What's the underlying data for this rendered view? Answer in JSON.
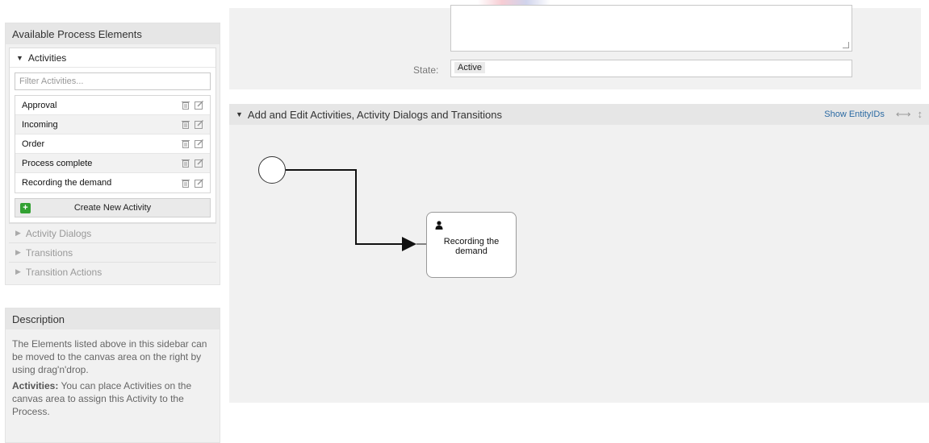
{
  "sidebar": {
    "available_title": "Available Process Elements",
    "activities": {
      "label": "Activities",
      "filter_placeholder": "Filter Activities...",
      "items": [
        {
          "label": "Approval"
        },
        {
          "label": "Incoming"
        },
        {
          "label": "Order"
        },
        {
          "label": "Process complete"
        },
        {
          "label": "Recording the demand"
        }
      ],
      "create_label": "Create New Activity"
    },
    "collapsed_sections": [
      {
        "label": "Activity Dialogs"
      },
      {
        "label": "Transitions"
      },
      {
        "label": "Transition Actions"
      }
    ],
    "description": {
      "title": "Description",
      "text1": "The Elements listed above in this sidebar can be moved to the canvas area on the right by using drag'n'drop.",
      "text2_bold": "Activities:",
      "text2": " You can place Activities on the canvas area to assign this Activity to the Process."
    }
  },
  "main": {
    "state_label": "State:",
    "state_value": "Active",
    "canvas_title": "Add and Edit Activities, Activity Dialogs and Transitions",
    "show_entity_ids": "Show EntityIDs",
    "activity_box_label": "Recording the demand"
  },
  "icons": {
    "delete": "trash-icon",
    "edit": "edit-icon",
    "add": "plus-icon",
    "user": "user-icon"
  },
  "colors": {
    "link": "#2b6aa3",
    "add_button": "#33a133"
  }
}
